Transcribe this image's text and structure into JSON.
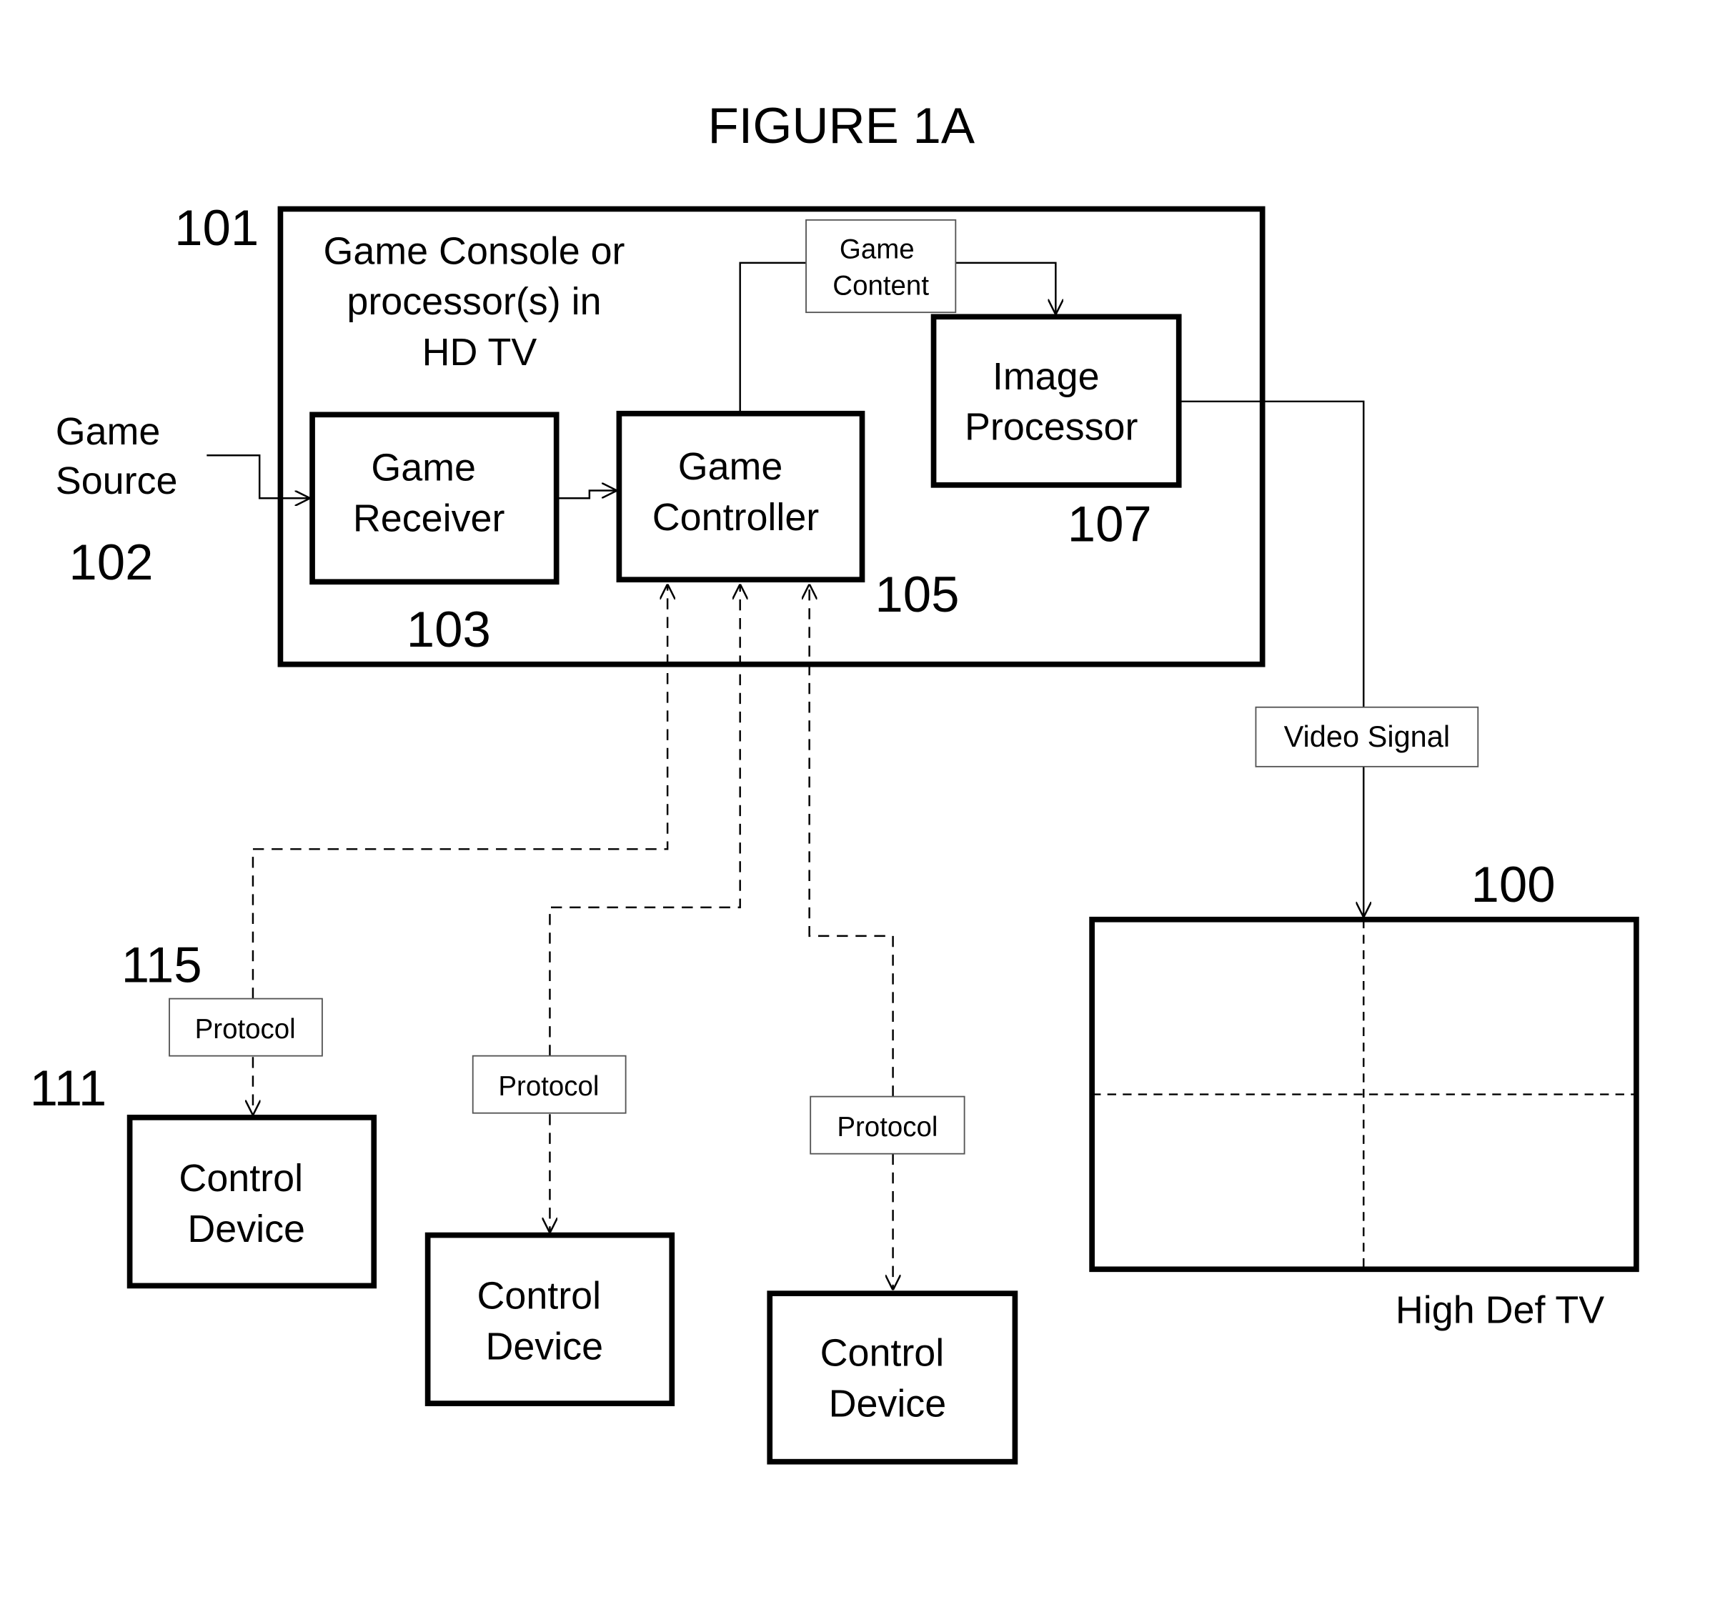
{
  "figure": {
    "title": "FIGURE 1A"
  },
  "console": {
    "ref": "101",
    "label_lines": [
      "Game Console or",
      "processor(s) in",
      "HD TV"
    ]
  },
  "game_source": {
    "label_lines": [
      "Game",
      "Source"
    ],
    "ref": "102"
  },
  "game_receiver": {
    "label_lines": [
      "Game",
      "Receiver"
    ],
    "ref": "103"
  },
  "game_controller": {
    "label_lines": [
      "Game",
      "Controller"
    ],
    "ref": "105"
  },
  "image_processor": {
    "label_lines": [
      "Image",
      "Processor"
    ],
    "ref": "107"
  },
  "game_content": {
    "label_lines": [
      "Game",
      "Content"
    ]
  },
  "video_signal": {
    "label": "Video Signal"
  },
  "tv": {
    "ref": "100",
    "label": "High Def TV"
  },
  "control_devices": [
    {
      "label_lines": [
        "Control",
        "Device"
      ],
      "ref": "111",
      "protocol_label": "Protocol",
      "protocol_ref": "115"
    },
    {
      "label_lines": [
        "Control",
        "Device"
      ],
      "protocol_label": "Protocol"
    },
    {
      "label_lines": [
        "Control",
        "Device"
      ],
      "protocol_label": "Protocol"
    }
  ]
}
